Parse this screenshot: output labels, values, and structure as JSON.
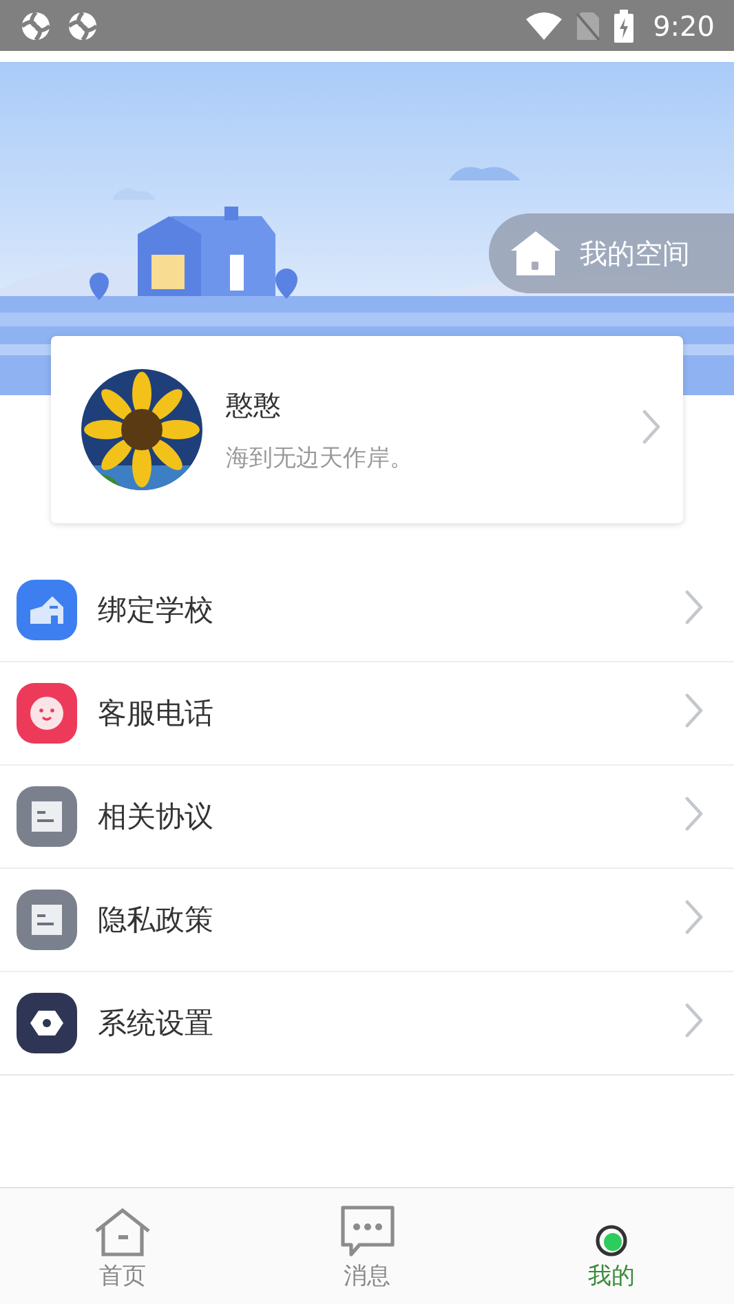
{
  "status_bar": {
    "time": "9:20"
  },
  "banner": {
    "space_button": "我的空间"
  },
  "profile": {
    "name": "憨憨",
    "motto": "海到无边天作岸。"
  },
  "menu": [
    {
      "label": "绑定学校",
      "kind": "school"
    },
    {
      "label": "客服电话",
      "kind": "service"
    },
    {
      "label": "相关协议",
      "kind": "document"
    },
    {
      "label": "隐私政策",
      "kind": "document"
    },
    {
      "label": "系统设置",
      "kind": "settings"
    }
  ],
  "tab_bar": [
    {
      "label": "首页",
      "kind": "home",
      "selected": false
    },
    {
      "label": "消息",
      "kind": "message",
      "selected": false
    },
    {
      "label": "我的",
      "kind": "profile",
      "selected": true
    }
  ]
}
